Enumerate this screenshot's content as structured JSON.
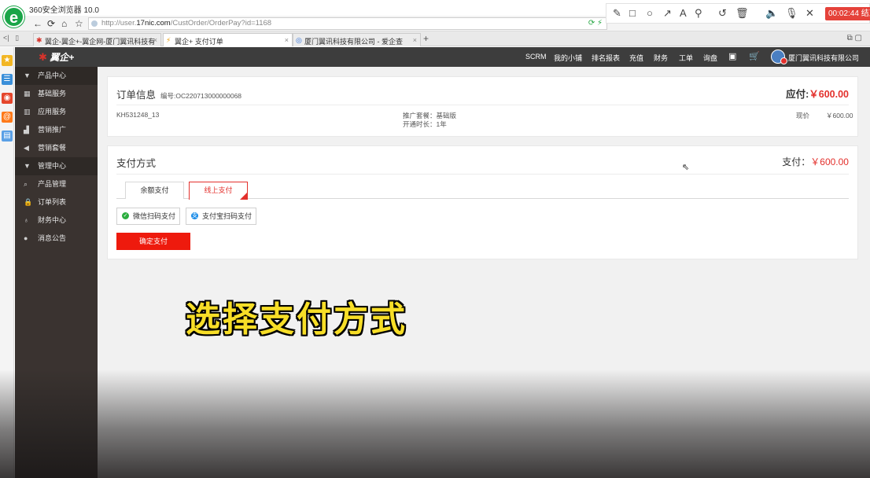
{
  "browser": {
    "title": "360安全浏览器 10.0",
    "logo_letter": "e",
    "url_prefix": "http://user.",
    "url_domain": "17nic.com",
    "url_path": "/CustOrder/OrderPay?id=1168",
    "tabs": [
      {
        "label": "翼企-翼企+-翼企网-厦门翼讯科技有"
      },
      {
        "label": "翼企+ 支付订单"
      },
      {
        "label": "厦门翼讯科技有限公司 - 爱企查"
      }
    ]
  },
  "recorder": {
    "time": "00:02:44 结束"
  },
  "app": {
    "logo": "翼企+",
    "nav": [
      "SCRM",
      "我的小铺",
      "排名报表",
      "充值",
      "财务",
      "工单",
      "询盘"
    ],
    "company": "厦门翼讯科技有限公司"
  },
  "menu": [
    {
      "label": "产品中心",
      "group": true
    },
    {
      "label": "基础服务"
    },
    {
      "label": "应用服务"
    },
    {
      "label": "营销推广"
    },
    {
      "label": "营销套餐"
    },
    {
      "label": "管理中心",
      "group": true
    },
    {
      "label": "产品管理"
    },
    {
      "label": "订单列表"
    },
    {
      "label": "财务中心"
    },
    {
      "label": "消息公告"
    }
  ],
  "order": {
    "title": "订单信息",
    "number": "编号:OC220713000000068",
    "payable_label": "应付:",
    "payable_amount": "￥600.00",
    "customer_code": "KH531248_13",
    "package": "推广套餐：基础版",
    "duration": "开通时长：1年",
    "price_label": "现价",
    "price": "￥600.00"
  },
  "payment": {
    "title": "支付方式",
    "total_label": "支付：",
    "total_amount": "￥600.00",
    "tabs": [
      "余额支付",
      "线上支付"
    ],
    "active_tab": "线上支付",
    "methods": [
      "微信扫码支付",
      "支付宝扫码支付"
    ],
    "confirm": "确定支付"
  },
  "caption": "选择支付方式",
  "colors": {
    "accent": "#e3302c",
    "button": "#ee1a0d",
    "header": "#3d3d3d",
    "menu": "#3a3330",
    "caption": "#f7de27"
  }
}
